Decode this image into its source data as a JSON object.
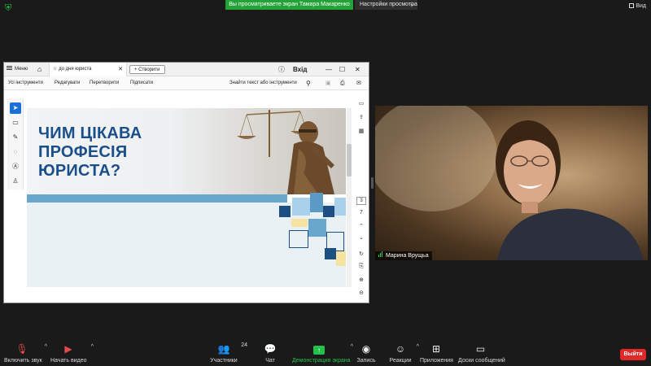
{
  "top_banner": {
    "sharing_text": "Вы просматриваете экран Тамара Макаренко",
    "view_settings_label": "Настройки просмотра",
    "view_button_label": "Вид"
  },
  "shared_app": {
    "menu_label": "Меню",
    "tab_title": "до дня юриста",
    "create_button": "Створити",
    "login_label": "Вхід",
    "toolbar": {
      "all_tools": "Усі інструменти",
      "edit": "Редагувати",
      "convert": "Перетворити",
      "sign": "Підписати",
      "search": "Знайти текст або інструменти"
    },
    "page_number": "3",
    "page_total": "7",
    "slide": {
      "headline_lines": [
        "ЧИМ ЦІКАВА",
        "ПРОФЕСІЯ",
        "ЮРИСТА?"
      ]
    }
  },
  "video": {
    "participant_name": "Марина Врущьа"
  },
  "bottom_bar": {
    "audio": "Включить звук",
    "video": "Начать видео",
    "participants": "Участники",
    "participants_count": "24",
    "chat": "Чат",
    "share_screen": "Демонстрация экрана",
    "record": "Запись",
    "reactions": "Реакции",
    "apps": "Приложения",
    "whiteboards": "Доски сообщений",
    "leave": "Выйти"
  },
  "colors": {
    "share_green": "#23a337",
    "leave_red": "#e02828",
    "slide_blue": "#1b4f8a",
    "band_blue": "#6aa7cc"
  }
}
